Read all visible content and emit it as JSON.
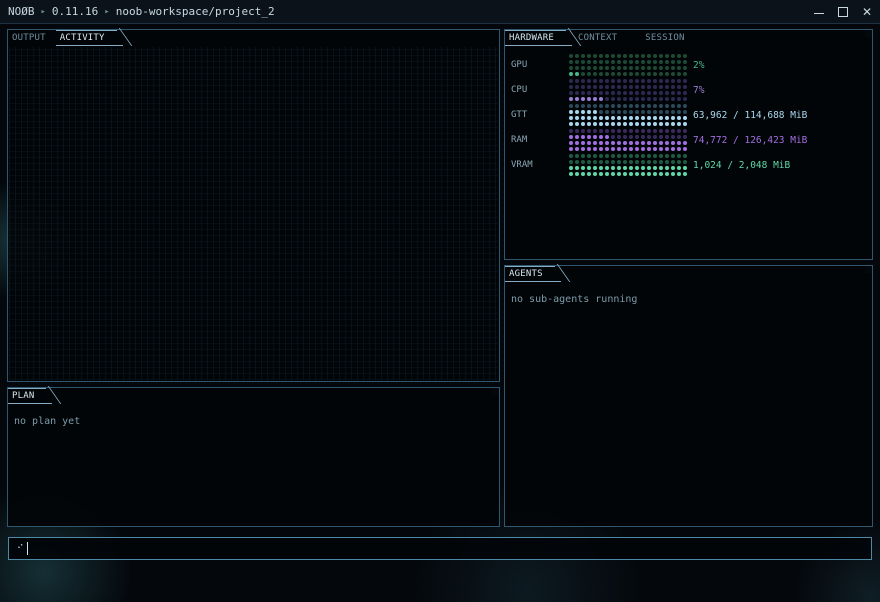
{
  "titlebar": {
    "app": "NOØB",
    "version": "0.11.16",
    "path": "noob-workspace/project_2",
    "sep1": "▸",
    "sep2": "▸",
    "close_glyph": "✕"
  },
  "left_top": {
    "tabs": [
      {
        "label": "OUTPUT",
        "active": false
      },
      {
        "label": "ACTIVITY",
        "active": true
      }
    ]
  },
  "plan": {
    "tab_label": "PLAN",
    "empty_text": "no plan yet"
  },
  "right_top": {
    "tabs": [
      {
        "label": "HARDWARE",
        "active": true
      },
      {
        "label": "CONTEXT",
        "active": false
      },
      {
        "label": "SESSION",
        "active": false
      }
    ],
    "rows": [
      {
        "label": "GPU",
        "value": "2%",
        "fraction": 0.02,
        "color": "#46b88a",
        "dim": "#1c4a34"
      },
      {
        "label": "CPU",
        "value": "7%",
        "fraction": 0.07,
        "color": "#9b7fd6",
        "dim": "#2f2850"
      },
      {
        "label": "GTT",
        "value": "63,962 / 114,688 MiB",
        "fraction": 0.557,
        "color": "#a9d8ee",
        "dim": "#2c4a5a"
      },
      {
        "label": "RAM",
        "value": "74,772 / 126,423 MiB",
        "fraction": 0.591,
        "color": "#a26fe0",
        "dim": "#3a2a5c"
      },
      {
        "label": "VRAM",
        "value": "1,024 / 2,048 MiB",
        "fraction": 0.5,
        "color": "#5fd8a8",
        "dim": "#1f5a44"
      }
    ]
  },
  "agents": {
    "tab_label": "AGENTS",
    "empty_text": "no sub-agents running"
  },
  "input": {
    "spinner": "⠊",
    "value": ""
  }
}
